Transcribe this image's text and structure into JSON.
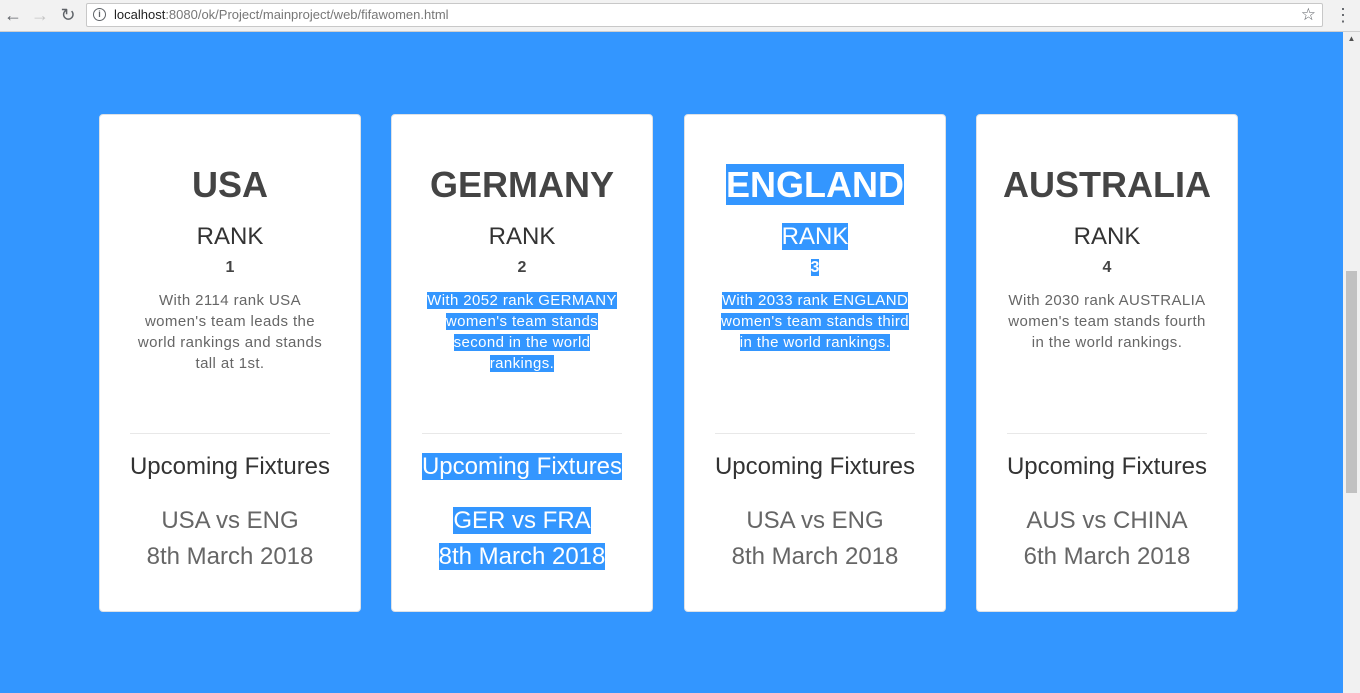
{
  "browser": {
    "url_host": "localhost",
    "url_path": ":8080/ok/Project/mainproject/web/fifawomen.html"
  },
  "icons": {
    "back": "back-arrow-icon",
    "forward": "forward-arrow-icon",
    "reload": "reload-icon",
    "info": "info-icon",
    "star": "star-icon",
    "menu": "kebab-menu-icon"
  },
  "colors": {
    "page_background": "#3396ff",
    "selection_highlight": "#3396ff"
  },
  "cards": [
    {
      "country": "USA",
      "rank_label": "RANK",
      "rank": "1",
      "description": "With 2114 rank USA women's team leads the world rankings and stands tall at 1st.",
      "fixtures_label": "Upcoming Fixtures",
      "match": "USA vs ENG",
      "date": "8th March 2018"
    },
    {
      "country": "GERMANY",
      "rank_label": "RANK",
      "rank": "2",
      "description": "With 2052 rank GERMANY women's team stands second in the world rankings.",
      "fixtures_label": "Upcoming Fixtures",
      "match": "GER vs FRA",
      "date": "8th March 2018"
    },
    {
      "country": "ENGLAND",
      "rank_label": "RANK",
      "rank": "3",
      "description": "With 2033 rank ENGLAND women's team stands third in the world rankings.",
      "fixtures_label": "Upcoming Fixtures",
      "match": "USA vs ENG",
      "date": "8th March 2018"
    },
    {
      "country": "AUSTRALIA",
      "rank_label": "RANK",
      "rank": "4",
      "description": "With 2030 rank AUSTRALIA women's team stands fourth in the world rankings.",
      "fixtures_label": "Upcoming Fixtures",
      "match": "AUS vs CHINA",
      "date": "6th March 2018"
    }
  ]
}
